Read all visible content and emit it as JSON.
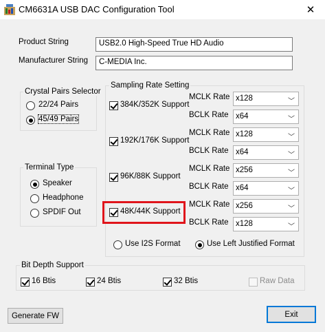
{
  "window": {
    "title": "CM6631A USB DAC Configuration Tool",
    "close_glyph": "✕"
  },
  "product": {
    "label": "Product String",
    "value": "USB2.0 High-Speed True HD Audio"
  },
  "manufacturer": {
    "label": "Manufacturer String",
    "value": "C-MEDIA Inc."
  },
  "crystal": {
    "title": "Crystal Pairs Selector",
    "options": [
      {
        "label": "22/24 Pairs",
        "selected": false
      },
      {
        "label": "45/49 Pairs",
        "selected": true
      }
    ]
  },
  "terminal": {
    "title": "Terminal Type",
    "options": [
      {
        "label": "Speaker",
        "selected": true
      },
      {
        "label": "Headphone",
        "selected": false
      },
      {
        "label": "SPDIF Out",
        "selected": false
      }
    ]
  },
  "sampling": {
    "title": "Sampling Rate Setting",
    "mclk_label": "MCLK Rate",
    "bclk_label": "BCLK Rate",
    "rows": [
      {
        "label": "384K/352K Support",
        "checked": true,
        "mclk": "x128",
        "bclk": "x64"
      },
      {
        "label": "192K/176K Support",
        "checked": true,
        "mclk": "x128",
        "bclk": "x64"
      },
      {
        "label": "96K/88K Support",
        "checked": true,
        "mclk": "x256",
        "bclk": "x64"
      },
      {
        "label": "48K/44K Support",
        "checked": true,
        "mclk": "x256",
        "bclk": "x128",
        "highlighted": true
      }
    ],
    "format_options": [
      {
        "label": "Use I2S Format",
        "selected": false
      },
      {
        "label": "Use Left Justified Format",
        "selected": true
      }
    ]
  },
  "bit_depth": {
    "title": "Bit Depth Support",
    "options": [
      {
        "label": "16 Btis",
        "checked": true,
        "enabled": true
      },
      {
        "label": "24 Btis",
        "checked": true,
        "enabled": true
      },
      {
        "label": "32 Btis",
        "checked": true,
        "enabled": true
      },
      {
        "label": "Raw Data",
        "checked": false,
        "enabled": false
      }
    ]
  },
  "buttons": {
    "generate": "Generate FW",
    "exit": "Exit"
  },
  "colors": {
    "highlight": "#e0141b",
    "default_button_border": "#0078d7"
  }
}
